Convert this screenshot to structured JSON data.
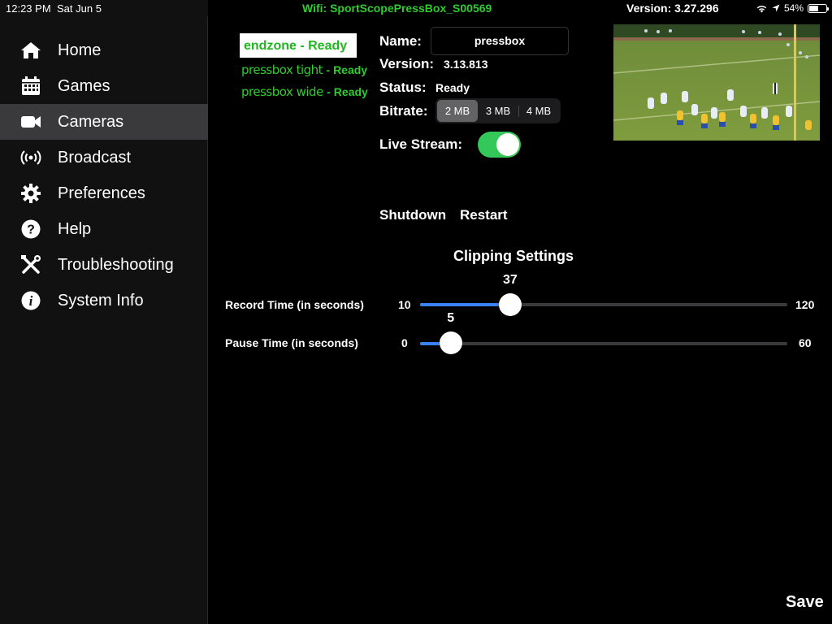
{
  "status_bar": {
    "time": "12:23 PM",
    "date": "Sat Jun 5",
    "wifi": "Wifi: SportScopePressBox_S00569",
    "version": "Version: 3.27.296",
    "battery": "54%",
    "battery_level": 0.54
  },
  "sidebar": {
    "items": [
      {
        "label": "Home",
        "icon": "home-icon"
      },
      {
        "label": "Games",
        "icon": "calendar-icon"
      },
      {
        "label": "Cameras",
        "icon": "video-camera-icon",
        "active": true
      },
      {
        "label": "Broadcast",
        "icon": "broadcast-icon"
      },
      {
        "label": "Preferences",
        "icon": "gear-icon"
      },
      {
        "label": "Help",
        "icon": "help-icon"
      },
      {
        "label": "Troubleshooting",
        "icon": "tools-icon"
      },
      {
        "label": "System Info",
        "icon": "info-icon"
      }
    ]
  },
  "cameras": [
    {
      "name": "endzone",
      "status": "- Ready",
      "selected": true
    },
    {
      "name": "pressbox tight",
      "status": "- Ready"
    },
    {
      "name": "pressbox wide",
      "status": "- Ready"
    }
  ],
  "detail": {
    "name_label": "Name:",
    "name_value": "pressbox",
    "version_label": "Version:",
    "version_value": "3.13.813",
    "status_label": "Status:",
    "status_value": "Ready",
    "bitrate_label": "Bitrate:",
    "bitrate_options": [
      "2 MB",
      "3 MB",
      "4 MB"
    ],
    "bitrate_selected": "2 MB",
    "live_stream_label": "Live Stream:",
    "live_stream_on": true
  },
  "actions": {
    "shutdown": "Shutdown",
    "restart": "Restart"
  },
  "clipping": {
    "title": "Clipping Settings",
    "record": {
      "label": "Record Time (in seconds)",
      "min": "10",
      "max": "120",
      "value": "37",
      "min_num": 10,
      "max_num": 120,
      "value_num": 37
    },
    "pause": {
      "label": "Pause Time (in seconds)",
      "min": "0",
      "max": "60",
      "value": "5",
      "min_num": 0,
      "max_num": 60,
      "value_num": 5
    }
  },
  "save_label": "Save",
  "colors": {
    "accent_green": "#2ecc2e",
    "toggle_green": "#34c759",
    "slider_blue": "#3b82f6",
    "sidebar_active": "#3a3a3c"
  }
}
